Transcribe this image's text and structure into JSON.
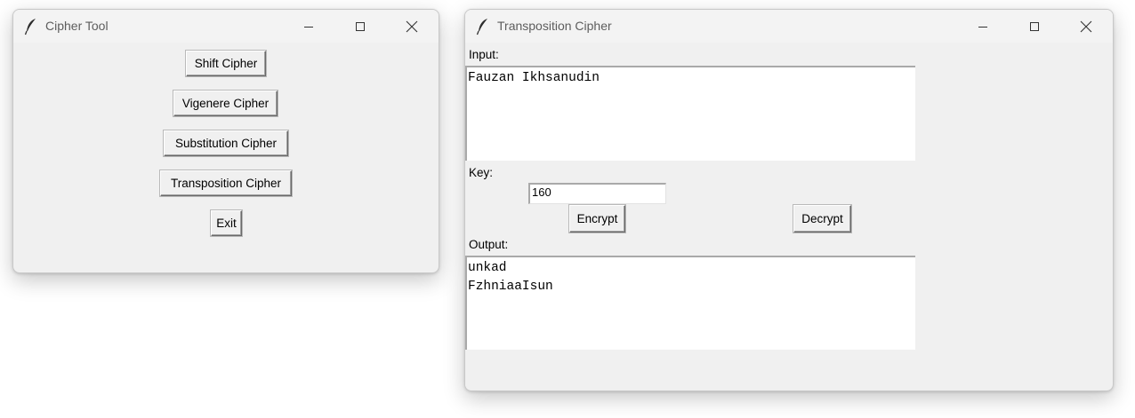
{
  "colors": {
    "window_bg": "#f0f0f0",
    "titlebar_bg": "#f3f3f3",
    "title_text": "#5d5d5d"
  },
  "cipher_tool": {
    "title": "Cipher Tool",
    "icon": "feather-icon",
    "buttons": {
      "shift": "Shift Cipher",
      "vigenere": "Vigenere Cipher",
      "substitution": "Substitution Cipher",
      "transposition": "Transposition Cipher",
      "exit": "Exit"
    }
  },
  "transposition_window": {
    "title": "Transposition Cipher",
    "icon": "feather-icon",
    "input_label": "Input:",
    "input_value": "Fauzan Ikhsanudin",
    "key_label": "Key:",
    "key_value": "160",
    "encrypt_label": "Encrypt",
    "decrypt_label": "Decrypt",
    "output_label": "Output:",
    "output_value": "unkad\nFzhniaaIsun"
  }
}
